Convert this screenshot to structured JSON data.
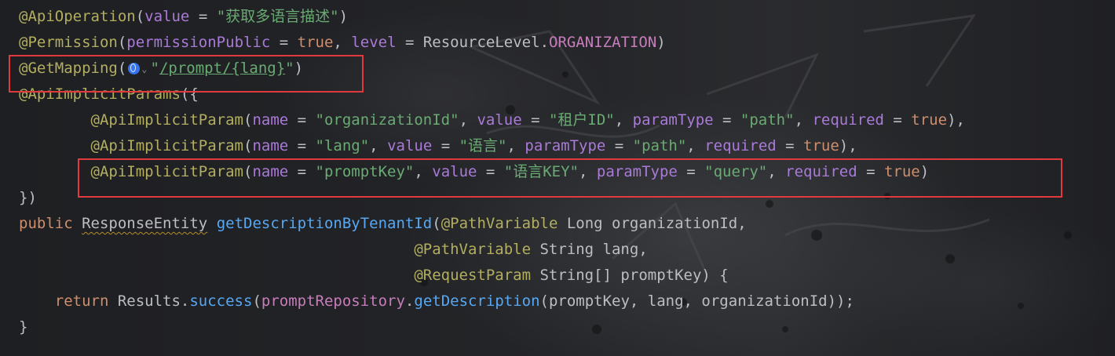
{
  "editor": {
    "lines": [
      {
        "tokens": [
          {
            "text": "@ApiOperation",
            "cls": "ann"
          },
          {
            "text": "(",
            "cls": "pl"
          },
          {
            "text": "value",
            "cls": "p"
          },
          {
            "text": " = ",
            "cls": "pl"
          },
          {
            "text": "\"获取多语言描述\"",
            "cls": "str"
          },
          {
            "text": ")",
            "cls": "pl"
          }
        ]
      },
      {
        "tokens": [
          {
            "text": "@Permission",
            "cls": "ann"
          },
          {
            "text": "(",
            "cls": "pl"
          },
          {
            "text": "permissionPublic",
            "cls": "p"
          },
          {
            "text": " = ",
            "cls": "pl"
          },
          {
            "text": "true",
            "cls": "kw"
          },
          {
            "text": ", ",
            "cls": "pl"
          },
          {
            "text": "level",
            "cls": "p"
          },
          {
            "text": " = ",
            "cls": "pl"
          },
          {
            "text": "ResourceLevel",
            "cls": "cls"
          },
          {
            "text": ".",
            "cls": "pl"
          },
          {
            "text": "ORGANIZATION",
            "cls": "cn"
          },
          {
            "text": ")",
            "cls": "pl"
          }
        ]
      },
      {
        "tokens": [
          {
            "text": "@GetMapping",
            "cls": "ann"
          },
          {
            "text": "(",
            "cls": "pl"
          },
          {
            "widget": "globe"
          },
          {
            "widget": "chev",
            "text": "⌄"
          },
          {
            "text": "\"",
            "cls": "str"
          },
          {
            "text": "/prompt/{lang}",
            "cls": "url"
          },
          {
            "text": "\"",
            "cls": "str"
          },
          {
            "text": ")",
            "cls": "pl"
          }
        ]
      },
      {
        "tokens": [
          {
            "text": "@ApiImplicitParams",
            "cls": "ann"
          },
          {
            "text": "({",
            "cls": "pl"
          }
        ]
      },
      {
        "tokens": [
          {
            "text": "        ",
            "cls": "pl"
          },
          {
            "text": "@ApiImplicitParam",
            "cls": "ann"
          },
          {
            "text": "(",
            "cls": "pl"
          },
          {
            "text": "name",
            "cls": "p"
          },
          {
            "text": " = ",
            "cls": "pl"
          },
          {
            "text": "\"organizationId\"",
            "cls": "str"
          },
          {
            "text": ", ",
            "cls": "pl"
          },
          {
            "text": "value",
            "cls": "p"
          },
          {
            "text": " = ",
            "cls": "pl"
          },
          {
            "text": "\"租户ID\"",
            "cls": "str"
          },
          {
            "text": ", ",
            "cls": "pl"
          },
          {
            "text": "paramType",
            "cls": "p"
          },
          {
            "text": " = ",
            "cls": "pl"
          },
          {
            "text": "\"path\"",
            "cls": "str"
          },
          {
            "text": ", ",
            "cls": "pl"
          },
          {
            "text": "required",
            "cls": "p"
          },
          {
            "text": " = ",
            "cls": "pl"
          },
          {
            "text": "true",
            "cls": "kw"
          },
          {
            "text": "),",
            "cls": "pl"
          }
        ]
      },
      {
        "tokens": [
          {
            "text": "        ",
            "cls": "pl"
          },
          {
            "text": "@ApiImplicitParam",
            "cls": "ann"
          },
          {
            "text": "(",
            "cls": "pl"
          },
          {
            "text": "name",
            "cls": "p"
          },
          {
            "text": " = ",
            "cls": "pl"
          },
          {
            "text": "\"lang\"",
            "cls": "str"
          },
          {
            "text": ", ",
            "cls": "pl"
          },
          {
            "text": "value",
            "cls": "p"
          },
          {
            "text": " = ",
            "cls": "pl"
          },
          {
            "text": "\"语言\"",
            "cls": "str"
          },
          {
            "text": ", ",
            "cls": "pl"
          },
          {
            "text": "paramType",
            "cls": "p"
          },
          {
            "text": " = ",
            "cls": "pl"
          },
          {
            "text": "\"path\"",
            "cls": "str"
          },
          {
            "text": ", ",
            "cls": "pl"
          },
          {
            "text": "required",
            "cls": "p"
          },
          {
            "text": " = ",
            "cls": "pl"
          },
          {
            "text": "true",
            "cls": "kw"
          },
          {
            "text": "),",
            "cls": "pl"
          }
        ]
      },
      {
        "tokens": [
          {
            "text": "        ",
            "cls": "pl"
          },
          {
            "text": "@ApiImplicitParam",
            "cls": "ann"
          },
          {
            "text": "(",
            "cls": "pl"
          },
          {
            "text": "name",
            "cls": "p"
          },
          {
            "text": " = ",
            "cls": "pl"
          },
          {
            "text": "\"promptKey\"",
            "cls": "str"
          },
          {
            "text": ", ",
            "cls": "pl"
          },
          {
            "text": "value",
            "cls": "p"
          },
          {
            "text": " = ",
            "cls": "pl"
          },
          {
            "text": "\"语言KEY\"",
            "cls": "str"
          },
          {
            "text": ", ",
            "cls": "pl"
          },
          {
            "text": "paramType",
            "cls": "p"
          },
          {
            "text": " = ",
            "cls": "pl"
          },
          {
            "text": "\"query\"",
            "cls": "str"
          },
          {
            "text": ", ",
            "cls": "pl"
          },
          {
            "text": "required",
            "cls": "p"
          },
          {
            "text": " = ",
            "cls": "pl"
          },
          {
            "text": "true",
            "cls": "kw"
          },
          {
            "text": ")",
            "cls": "pl"
          }
        ]
      },
      {
        "tokens": [
          {
            "text": "})",
            "cls": "pl"
          }
        ]
      },
      {
        "tokens": [
          {
            "text": "public",
            "cls": "kw"
          },
          {
            "text": " ",
            "cls": "pl"
          },
          {
            "text": "ResponseEntity",
            "cls": "cls squig"
          },
          {
            "text": " ",
            "cls": "pl"
          },
          {
            "text": "getDescriptionByTenantId",
            "cls": "fn"
          },
          {
            "text": "(",
            "cls": "pl"
          },
          {
            "text": "@PathVariable",
            "cls": "ann"
          },
          {
            "text": " Long organizationId,",
            "cls": "pl"
          }
        ]
      },
      {
        "tokens": [
          {
            "text": "                                            ",
            "cls": "pl"
          },
          {
            "text": "@PathVariable",
            "cls": "ann"
          },
          {
            "text": " String lang,",
            "cls": "pl"
          }
        ]
      },
      {
        "tokens": [
          {
            "text": "                                            ",
            "cls": "pl"
          },
          {
            "text": "@RequestParam",
            "cls": "ann"
          },
          {
            "text": " String[] promptKey) {",
            "cls": "pl"
          }
        ]
      },
      {
        "tokens": [
          {
            "text": "    ",
            "cls": "pl"
          },
          {
            "text": "return",
            "cls": "kw"
          },
          {
            "text": " Results.",
            "cls": "pl"
          },
          {
            "text": "success",
            "cls": "fn"
          },
          {
            "text": "(",
            "cls": "pl"
          },
          {
            "text": "promptRepository",
            "cls": "fld"
          },
          {
            "text": ".",
            "cls": "pl"
          },
          {
            "text": "getDescription",
            "cls": "fn"
          },
          {
            "text": "(promptKey, lang, organizationId));",
            "cls": "pl"
          }
        ]
      },
      {
        "tokens": [
          {
            "text": "}",
            "cls": "pl"
          }
        ]
      }
    ]
  },
  "highlight_color": "#e03a3e",
  "icons": {
    "mapping_globe": "globe-icon",
    "mapping_dropdown": "chevron-down-icon"
  }
}
